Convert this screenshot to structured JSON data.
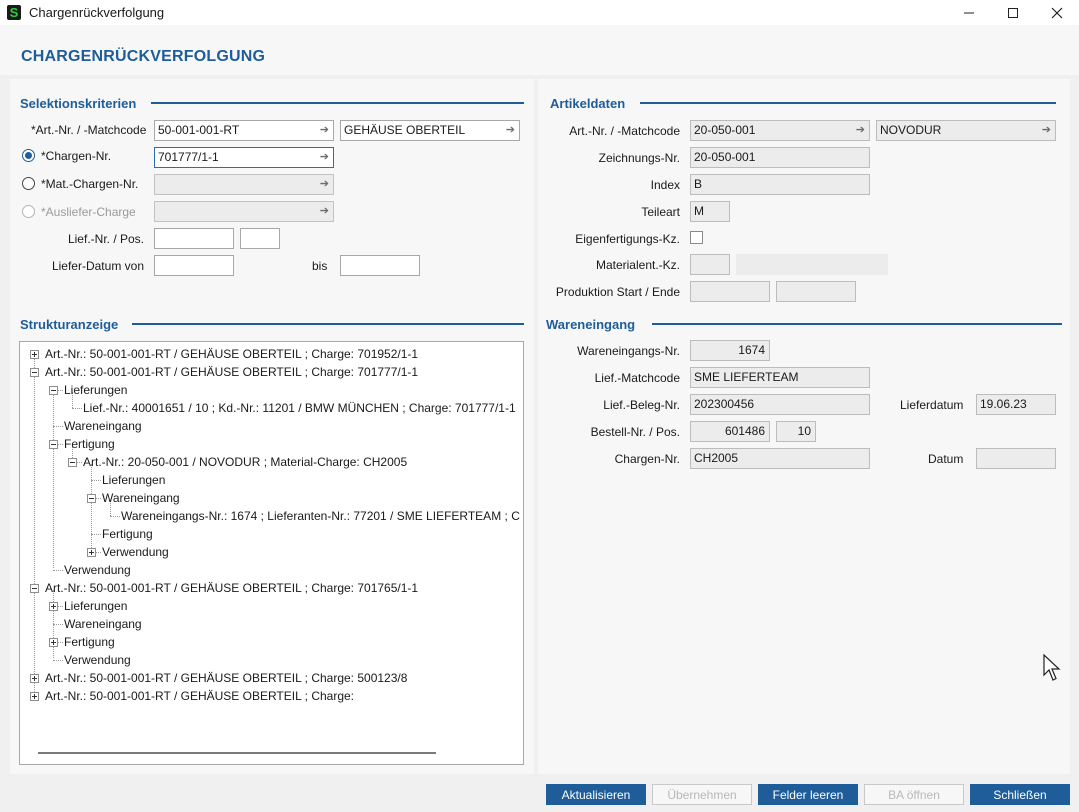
{
  "window": {
    "title": "Chargenrückverfolgung",
    "app_icon_glyph": "S"
  },
  "page_title": "CHARGENRÜCKVERFOLGUNG",
  "selection": {
    "title": "Selektionskriterien",
    "art_label": "*Art.-Nr. / -Matchcode",
    "art_value": "50-001-001-RT",
    "art_name": "GEHÄUSE OBERTEIL",
    "charge_label": "*Chargen-Nr.",
    "charge_value": "701777/1-1",
    "mat_charge_label": "*Mat.-Chargen-Nr.",
    "mat_charge_value": "",
    "auslief_label": "*Ausliefer-Charge",
    "auslief_value": "",
    "lief_pos_label": "Lief.-Nr. / Pos.",
    "lief_value": "",
    "pos_value": "",
    "datum_von_label": "Liefer-Datum von",
    "datum_von_value": "",
    "bis_label": "bis",
    "datum_bis_value": ""
  },
  "structure": {
    "title": "Strukturanzeige",
    "nodes": [
      "Art.-Nr.: 50-001-001-RT / GEHÄUSE OBERTEIL ; Charge: 701952/1-1",
      "Art.-Nr.: 50-001-001-RT / GEHÄUSE OBERTEIL ; Charge: 701777/1-1",
      "Lieferungen",
      "Lief.-Nr.: 40001651 / 10 ; Kd.-Nr.: 11201 / BMW MÜNCHEN ; Charge: 701777/1-1",
      "Wareneingang",
      "Fertigung",
      "Art.-Nr.: 20-050-001 / NOVODUR ; Material-Charge: CH2005",
      "Lieferungen",
      "Wareneingang",
      "Wareneingangs-Nr.: 1674 ; Lieferanten-Nr.: 77201 / SME LIEFERTEAM ; C",
      "Fertigung",
      "Verwendung",
      "Verwendung",
      "Art.-Nr.: 50-001-001-RT / GEHÄUSE OBERTEIL ; Charge: 701765/1-1",
      "Lieferungen",
      "Wareneingang",
      "Fertigung",
      "Verwendung",
      "Art.-Nr.: 50-001-001-RT / GEHÄUSE OBERTEIL ; Charge: 500123/8",
      "Art.-Nr.: 50-001-001-RT / GEHÄUSE OBERTEIL ; Charge:"
    ]
  },
  "article": {
    "title": "Artikeldaten",
    "art_label": "Art.-Nr. / -Matchcode",
    "art_value": "20-050-001",
    "art_name": "NOVODUR",
    "zeichnung_label": "Zeichnungs-Nr.",
    "zeichnung_value": "20-050-001",
    "index_label": "Index",
    "index_value": "B",
    "teileart_label": "Teileart",
    "teileart_value": "M",
    "eigen_label": "Eigenfertigungs-Kz.",
    "materialent_label": "Materialent.-Kz.",
    "materialent_value": "",
    "materialent_text": "",
    "produktion_label": "Produktion Start / Ende",
    "produktion_start": "",
    "produktion_ende": ""
  },
  "goods_receipt": {
    "title": "Wareneingang",
    "we_nr_label": "Wareneingangs-Nr.",
    "we_nr_value": "1674",
    "lief_match_label": "Lief.-Matchcode",
    "lief_match_value": "SME LIEFERTEAM",
    "beleg_label": "Lief.-Beleg-Nr.",
    "beleg_value": "202300456",
    "lieferdatum_label": "Lieferdatum",
    "lieferdatum_value": "19.06.23",
    "bestell_label": "Bestell-Nr. / Pos.",
    "bestell_value": "601486",
    "bestell_pos_value": "10",
    "chargen_label": "Chargen-Nr.",
    "chargen_value": "CH2005",
    "datum_label": "Datum",
    "datum_value": ""
  },
  "buttons": {
    "aktualisieren": "Aktualisieren",
    "uebernehmen": "Übernehmen",
    "felder_leeren": "Felder leeren",
    "ba_oeffnen": "BA öffnen",
    "schliessen": "Schließen"
  },
  "colors": {
    "accent": "#1e5d99",
    "background": "#f0f0f0",
    "panel": "#f7f7f7"
  }
}
